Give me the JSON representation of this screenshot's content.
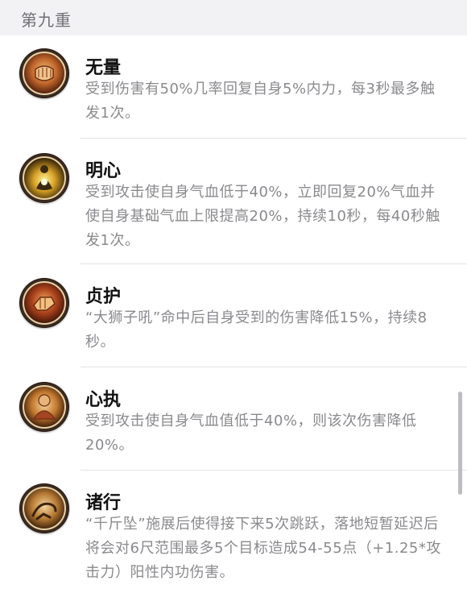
{
  "section": {
    "title": "第九重"
  },
  "skills": [
    {
      "name": "无量",
      "icon": "fist-icon",
      "description": "受到伤害有50%几率回复自身5%内力，每3秒最多触发1次。"
    },
    {
      "name": "明心",
      "icon": "meditation-icon",
      "description": "受到攻击使自身气血低于40%，立即回复20%气血并使自身基础气血上限提高20%，持续10秒，每40秒触发1次。"
    },
    {
      "name": "贞护",
      "icon": "guard-fist-icon",
      "description": "“大狮子吼”命中后自身受到的伤害降低15%，持续8秒。"
    },
    {
      "name": "心执",
      "icon": "monk-icon",
      "description": "受到攻击使自身气血值低于40%，则该次伤害降低20%。"
    },
    {
      "name": "诸行",
      "icon": "leap-icon",
      "description": "“千斤坠”施展后使得接下来5次跳跃，落地短暂延迟后将会对6尺范围最多5个目标造成54-55点（+1.25*攻击力）阳性内功伤害。"
    }
  ]
}
